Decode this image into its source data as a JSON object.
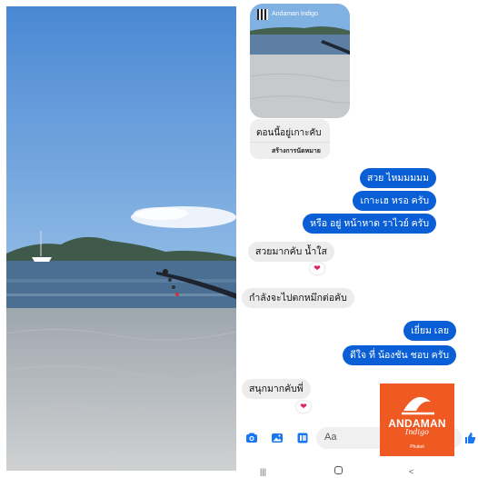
{
  "thumbnail": {
    "caption": "Andaman Indigo"
  },
  "event_card": {
    "title": "ตอนนี้อยู่เกาะคับ",
    "action": "สร้างการนัดหมาย"
  },
  "messages": [
    {
      "text": "สวย ไหมมมมม",
      "direction": "outgoing"
    },
    {
      "text": "เกาะเฮ หรอ ครับ",
      "direction": "outgoing"
    },
    {
      "text": "หรือ อยู่ หน้าหาด ราไวย์ ครับ",
      "direction": "outgoing"
    },
    {
      "text": "สวยมากคับ น้ำใส",
      "direction": "incoming",
      "reaction": "heart"
    },
    {
      "text": "กำลังจะไปตกหมึกต่อคับ",
      "direction": "incoming"
    },
    {
      "text": "เยี่ยม เลย",
      "direction": "outgoing"
    },
    {
      "text": "ดีใจ ที่ น้องชัน ชอบ ครับ",
      "direction": "outgoing"
    },
    {
      "text": "สนุกมากคับพี่",
      "direction": "incoming",
      "reaction": "heart"
    }
  ],
  "reaction_glyph": "❤",
  "composer": {
    "placeholder": "Aa",
    "icons": [
      "camera-icon",
      "gallery-icon",
      "sticker-icon",
      "like-icon"
    ]
  },
  "watermark": {
    "brand": "ANDAMAN",
    "script": "Indigo",
    "location": "Phuket"
  },
  "colors": {
    "outgoing_bubble": "#0a5fd6",
    "incoming_bubble": "#ececec",
    "accent_icon": "#1877f2",
    "brand_orange": "#ef5a23",
    "sky": "#4f8fd8",
    "sea": "#4a6f93",
    "sand": "#c6c9cc"
  },
  "navigation": {
    "buttons": [
      "recent-apps",
      "home",
      "back"
    ]
  }
}
